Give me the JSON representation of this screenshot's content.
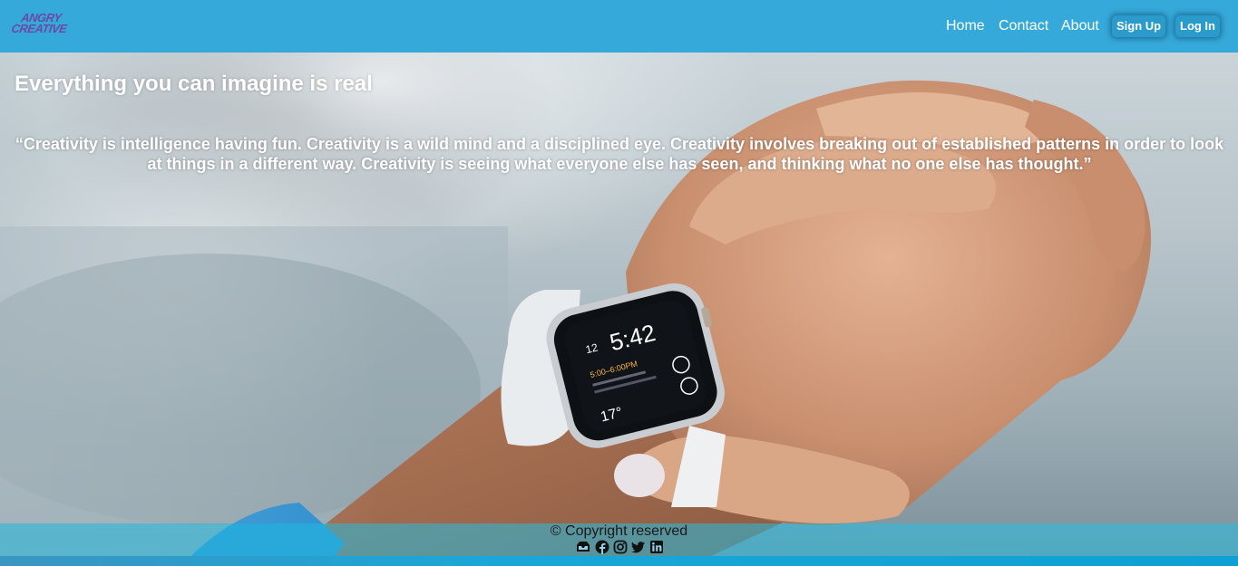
{
  "logo": {
    "line1": "ANGRY",
    "line2": "CREATIVE"
  },
  "nav": {
    "links": [
      "Home",
      "Contact",
      "About"
    ],
    "signup_label": "Sign Up",
    "login_label": "Log In"
  },
  "hero": {
    "headline": "Everything you can imagine is real",
    "quote": "“Creativity is intelligence having fun. Creativity is a wild mind and a disciplined eye. Creativity involves breaking out of established patterns in order to look at things in a different way. Creativity is seeing what everyone else has seen, and thinking what no one else has thought.”",
    "watch_time": "5:42",
    "watch_date": "12",
    "watch_event": "5:00–6:00PM",
    "watch_temp": "17°"
  },
  "footer": {
    "copyright": "© Copyright reserved",
    "social_icons": [
      "mail-icon",
      "facebook-icon",
      "instagram-icon",
      "twitter-icon",
      "linkedin-icon"
    ]
  },
  "colors": {
    "navbar": "#35a9d9",
    "logo": "#6b4aa6",
    "button": "#2b9bcb",
    "footer": "#28bee1"
  }
}
